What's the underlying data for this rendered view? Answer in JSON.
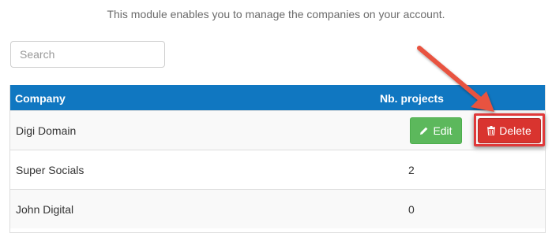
{
  "intro_text": "This module enables you to manage the companies on your account.",
  "search": {
    "placeholder": "Search",
    "value": ""
  },
  "table": {
    "headers": {
      "company": "Company",
      "projects": "Nb. projects"
    },
    "rows": [
      {
        "company": "Digi Domain",
        "projects": "",
        "actions": {
          "edit_label": "Edit",
          "delete_label": "Delete"
        }
      },
      {
        "company": "Super Socials",
        "projects": "2"
      },
      {
        "company": "John Digital",
        "projects": "0"
      }
    ]
  },
  "colors": {
    "header_bg": "#1077c1",
    "edit_button": "#5cb85c",
    "delete_button": "#d9342f",
    "annotation": "#e8523f"
  },
  "icons": {
    "edit": "pencil-icon",
    "delete": "trash-icon"
  }
}
